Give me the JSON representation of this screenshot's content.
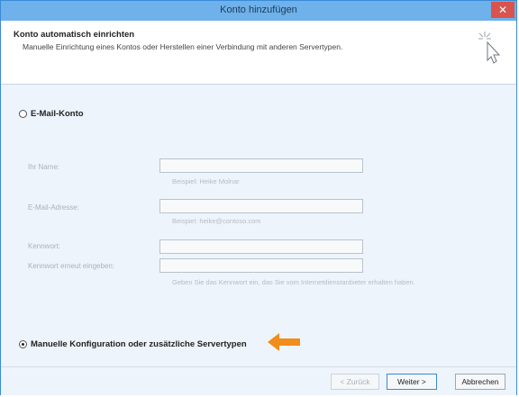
{
  "window": {
    "title": "Konto hinzufügen",
    "close_label": "✕"
  },
  "header": {
    "title": "Konto automatisch einrichten",
    "subtitle": "Manuelle Einrichtung eines Kontos oder Herstellen einer Verbindung mit anderen Servertypen."
  },
  "options": {
    "email_account": "E-Mail-Konto",
    "manual_config": "Manuelle Konfiguration oder zusätzliche Servertypen"
  },
  "form": {
    "name_label": "Ihr Name:",
    "name_hint": "Beispiel: Heike Molnar",
    "email_label": "E-Mail-Adresse:",
    "email_hint": "Beispiel: heike@contoso.com",
    "password_label": "Kennwort:",
    "password_repeat_label": "Kennwort erneut eingeben:",
    "password_hint": "Geben Sie das Kennwort ein, das Sie vom Internetdienstanbieter erhalten haben."
  },
  "footer": {
    "back_label": "< Zurück",
    "next_label": "Weiter >",
    "cancel_label": "Abbrechen"
  },
  "colors": {
    "titlebar": "#6fb1ea",
    "accent_arrow": "#f28c1a",
    "close": "#d9534f"
  },
  "icons": {
    "cursor": "cursor-sparkle-icon",
    "arrow": "arrow-left-icon"
  }
}
